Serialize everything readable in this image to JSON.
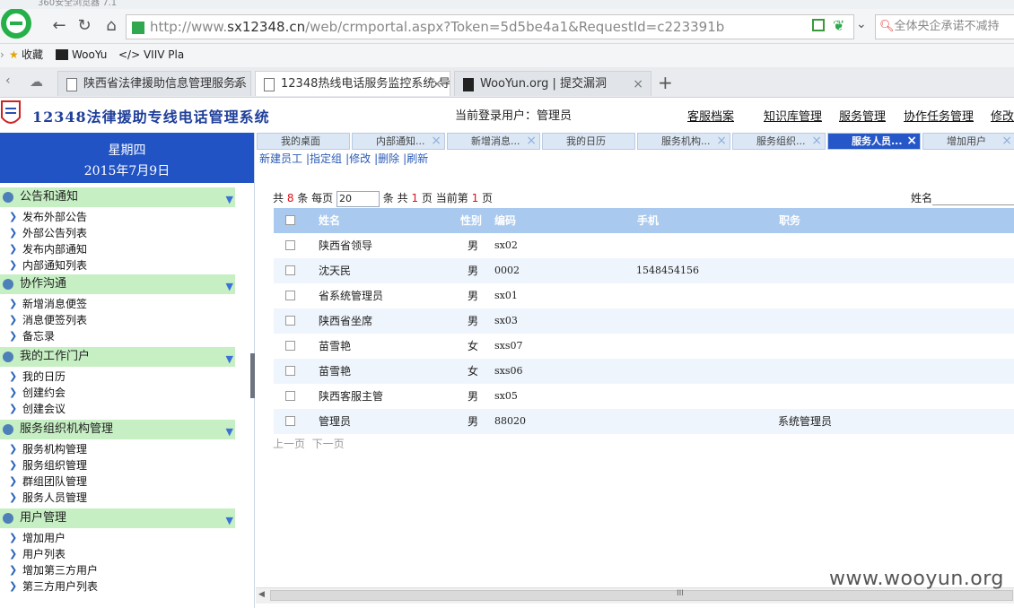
{
  "browser": {
    "title_partial": "360安全浏览器 7.1",
    "url_prefix": "http://www.",
    "url_host": "sx12348.cn",
    "url_rest": "/web/crmportal.aspx?Token=5d5be4a1&RequestId=c223391b",
    "search_placeholder": "全体央企承诺不减持",
    "bookmarks": [
      "收藏",
      "WooYu",
      "</> VIIV Pla"
    ],
    "tabs": [
      {
        "label": "陕西省法律援助信息管理服务系",
        "active": false
      },
      {
        "label": "12348热线电话服务监控系统-导",
        "active": true
      },
      {
        "label": "WooYun.org | 提交漏洞",
        "active": false
      }
    ],
    "new_tab": "+"
  },
  "app": {
    "title": "12348法律援助专线电话管理系统",
    "login_label": "当前登录用户：",
    "login_user": "管理员",
    "nav": [
      "客服档案",
      "知识库管理",
      "服务管理",
      "协作任务管理",
      "修改"
    ]
  },
  "sidebar": {
    "weekday": "星期四",
    "date": "2015年7月9日",
    "sections": [
      {
        "title": "公告和通知",
        "items": [
          "发布外部公告",
          "外部公告列表",
          "发布内部通知",
          "内部通知列表"
        ]
      },
      {
        "title": "协作沟通",
        "items": [
          "新增消息便签",
          "消息便签列表",
          "备忘录"
        ]
      },
      {
        "title": "我的工作门户",
        "items": [
          "我的日历",
          "创建约会",
          "创建会议"
        ]
      },
      {
        "title": "服务组织机构管理",
        "items": [
          "服务机构管理",
          "服务组织管理",
          "群组团队管理",
          "服务人员管理"
        ]
      },
      {
        "title": "用户管理",
        "items": [
          "增加用户",
          "用户列表",
          "增加第三方用户",
          "第三方用户列表"
        ]
      }
    ]
  },
  "inner_tabs": [
    {
      "label": "我的桌面",
      "active": false,
      "closable": false
    },
    {
      "label": "内部通知...",
      "active": false,
      "closable": true
    },
    {
      "label": "新增消息...",
      "active": false,
      "closable": true
    },
    {
      "label": "我的日历",
      "active": false,
      "closable": false
    },
    {
      "label": "服务机构...",
      "active": false,
      "closable": true
    },
    {
      "label": "服务组织...",
      "active": false,
      "closable": true
    },
    {
      "label": "服务人员...",
      "active": true,
      "closable": true
    },
    {
      "label": "增加用户",
      "active": false,
      "closable": true
    }
  ],
  "toolbar": [
    "新建员工",
    "|指定组",
    "|修改",
    "|删除",
    "|刷新"
  ],
  "pager": {
    "total_prefix": "共",
    "total": "8",
    "total_unit": "条  每页",
    "page_size": "20",
    "pages_prefix": "条  共",
    "pages": "1",
    "current_prefix": "页  当前第",
    "current": "1",
    "current_suffix": "页",
    "prev": "上一页",
    "next": "下一页"
  },
  "name_filter_label": "姓名",
  "table": {
    "headers": [
      "姓名",
      "性别",
      "编码",
      "手机",
      "职务"
    ],
    "rows": [
      {
        "name": "陕西省领导",
        "gender": "男",
        "code": "sx02",
        "phone": "",
        "title": ""
      },
      {
        "name": "沈天民",
        "gender": "男",
        "code": "0002",
        "phone": "1548454156",
        "title": ""
      },
      {
        "name": "省系统管理员",
        "gender": "男",
        "code": "sx01",
        "phone": "",
        "title": ""
      },
      {
        "name": "陕西省坐席",
        "gender": "男",
        "code": "sx03",
        "phone": "",
        "title": ""
      },
      {
        "name": "苗雪艳",
        "gender": "女",
        "code": "sxs07",
        "phone": "",
        "title": ""
      },
      {
        "name": "苗雪艳",
        "gender": "女",
        "code": "sxs06",
        "phone": "",
        "title": ""
      },
      {
        "name": "陕西客服主管",
        "gender": "男",
        "code": "sx05",
        "phone": "",
        "title": ""
      },
      {
        "name": "管理员",
        "gender": "男",
        "code": "88020",
        "phone": "",
        "title": "系统管理员"
      }
    ]
  },
  "scroll_grip": "III",
  "watermark": "www.wooyun.org",
  "colors": {
    "accent": "#2153c4",
    "section_bg": "#c7efc4",
    "grid_header": "#a9c9ef",
    "red": "#d9121b"
  }
}
